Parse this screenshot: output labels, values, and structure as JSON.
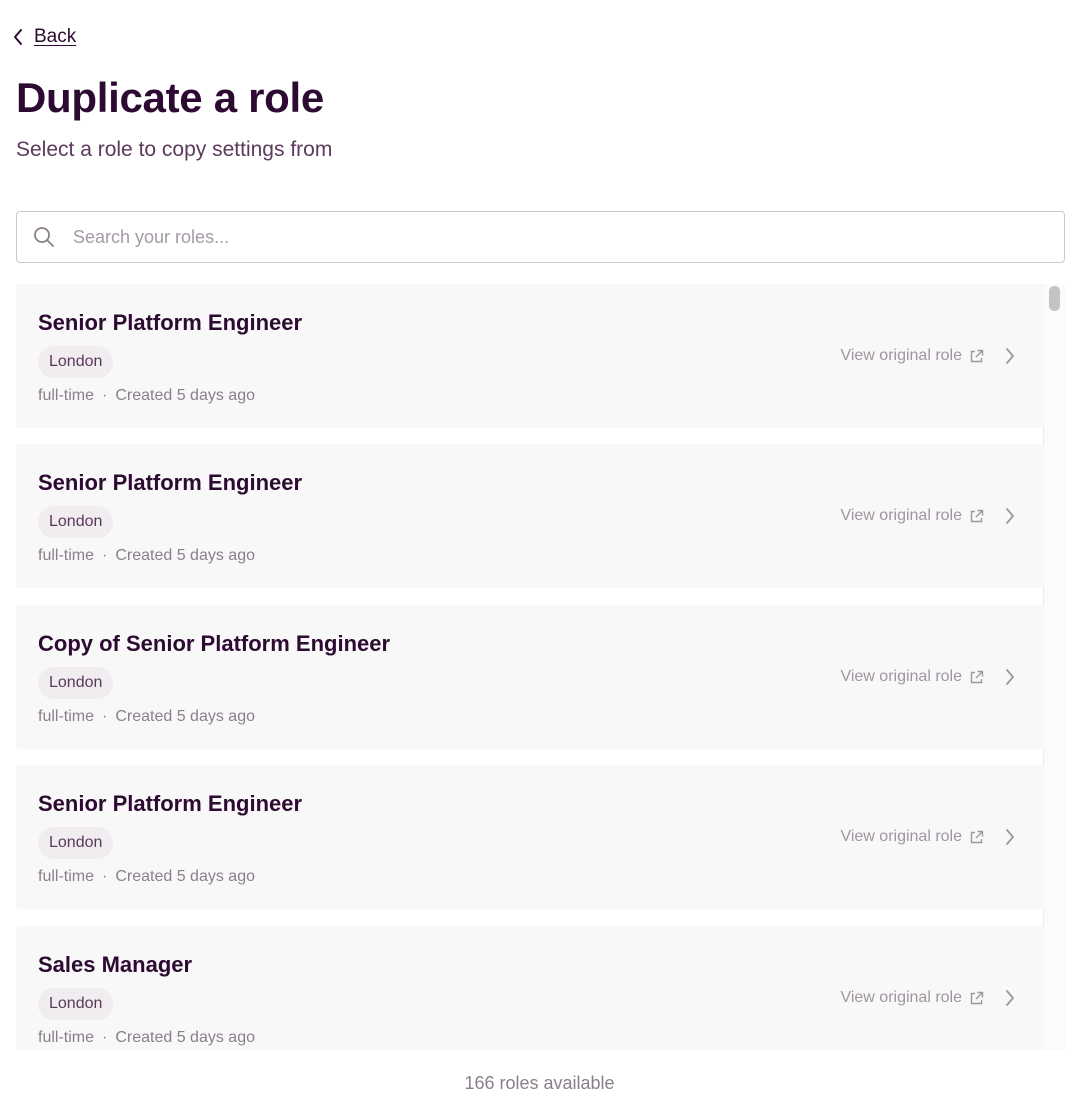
{
  "header": {
    "back_label": "Back",
    "title": "Duplicate a role",
    "subtitle": "Select a role to copy settings from"
  },
  "search": {
    "placeholder": "Search your roles...",
    "value": ""
  },
  "roles": [
    {
      "title": "Senior Platform Engineer",
      "location": "London",
      "type": "full-time",
      "created": "Created 5 days ago",
      "view_label": "View original role"
    },
    {
      "title": "Senior Platform Engineer",
      "location": "London",
      "type": "full-time",
      "created": "Created 5 days ago",
      "view_label": "View original role"
    },
    {
      "title": "Copy of Senior Platform Engineer",
      "location": "London",
      "type": "full-time",
      "created": "Created 5 days ago",
      "view_label": "View original role"
    },
    {
      "title": "Senior Platform Engineer",
      "location": "London",
      "type": "full-time",
      "created": "Created 5 days ago",
      "view_label": "View original role"
    },
    {
      "title": "Sales Manager",
      "location": "London",
      "type": "full-time",
      "created": "Created 5 days ago",
      "view_label": "View original role"
    }
  ],
  "meta_separator": "·",
  "footer": {
    "count_text": "166 roles available"
  },
  "colors": {
    "primary_text": "#2d0a31",
    "muted_text": "#8b7e8c",
    "card_bg": "#f8f8f8",
    "tag_bg": "#f0ecef"
  }
}
